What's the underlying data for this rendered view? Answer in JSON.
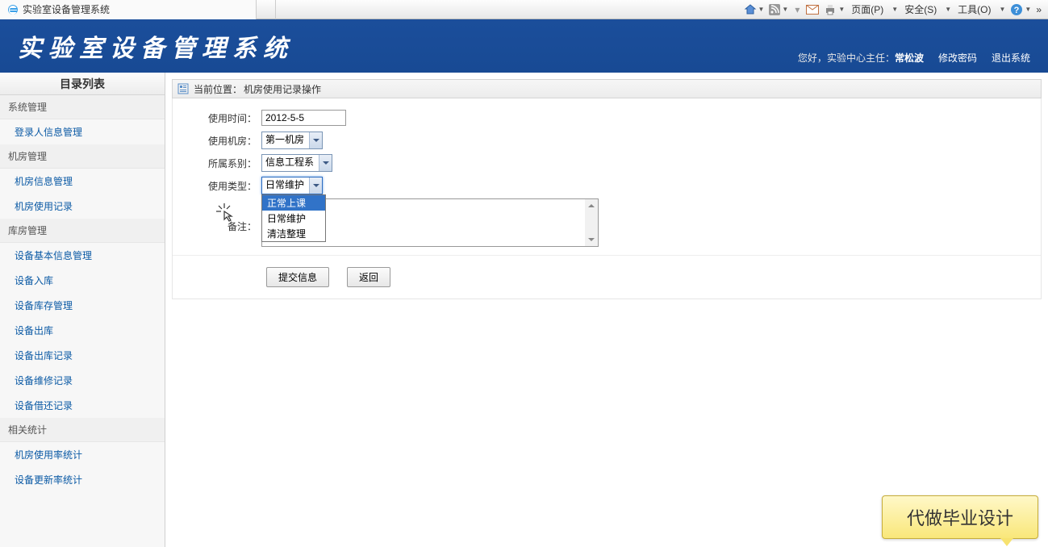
{
  "browser": {
    "tab_title": "实验室设备管理系统",
    "tools": {
      "page": "页面(P)",
      "safety": "安全(S)",
      "tools": "工具(O)"
    }
  },
  "header": {
    "title": "实验室设备管理系统",
    "hello_prefix": "您好，",
    "user_role": "实验中心主任：",
    "user_name": "常松波",
    "change_pw": "修改密码",
    "logout": "退出系统"
  },
  "sidebar": {
    "title": "目录列表",
    "groups": [
      {
        "cat": "系统管理",
        "items": [
          "登录人信息管理"
        ]
      },
      {
        "cat": "机房管理",
        "items": [
          "机房信息管理",
          "机房使用记录"
        ]
      },
      {
        "cat": "库房管理",
        "items": [
          "设备基本信息管理",
          "设备入库",
          "设备库存管理",
          "设备出库",
          "设备出库记录",
          "设备维修记录",
          "设备借还记录"
        ]
      },
      {
        "cat": "相关统计",
        "items": [
          "机房使用率统计",
          "设备更新率统计"
        ]
      }
    ]
  },
  "content": {
    "location_prefix": "当前位置：",
    "location_value": "机房使用记录操作",
    "form": {
      "time_label": "使用时间：",
      "time_value": "2012-5-5",
      "room_label": "使用机房：",
      "room_value": "第一机房",
      "dept_label": "所属系别：",
      "dept_value": "信息工程系",
      "type_label": "使用类型：",
      "type_value": "日常维护",
      "type_options": [
        "正常上课",
        "日常维护",
        "清洁整理"
      ],
      "remark_label": "备注："
    },
    "buttons": {
      "submit": "提交信息",
      "back": "返回"
    }
  },
  "tooltip": "代做毕业设计"
}
